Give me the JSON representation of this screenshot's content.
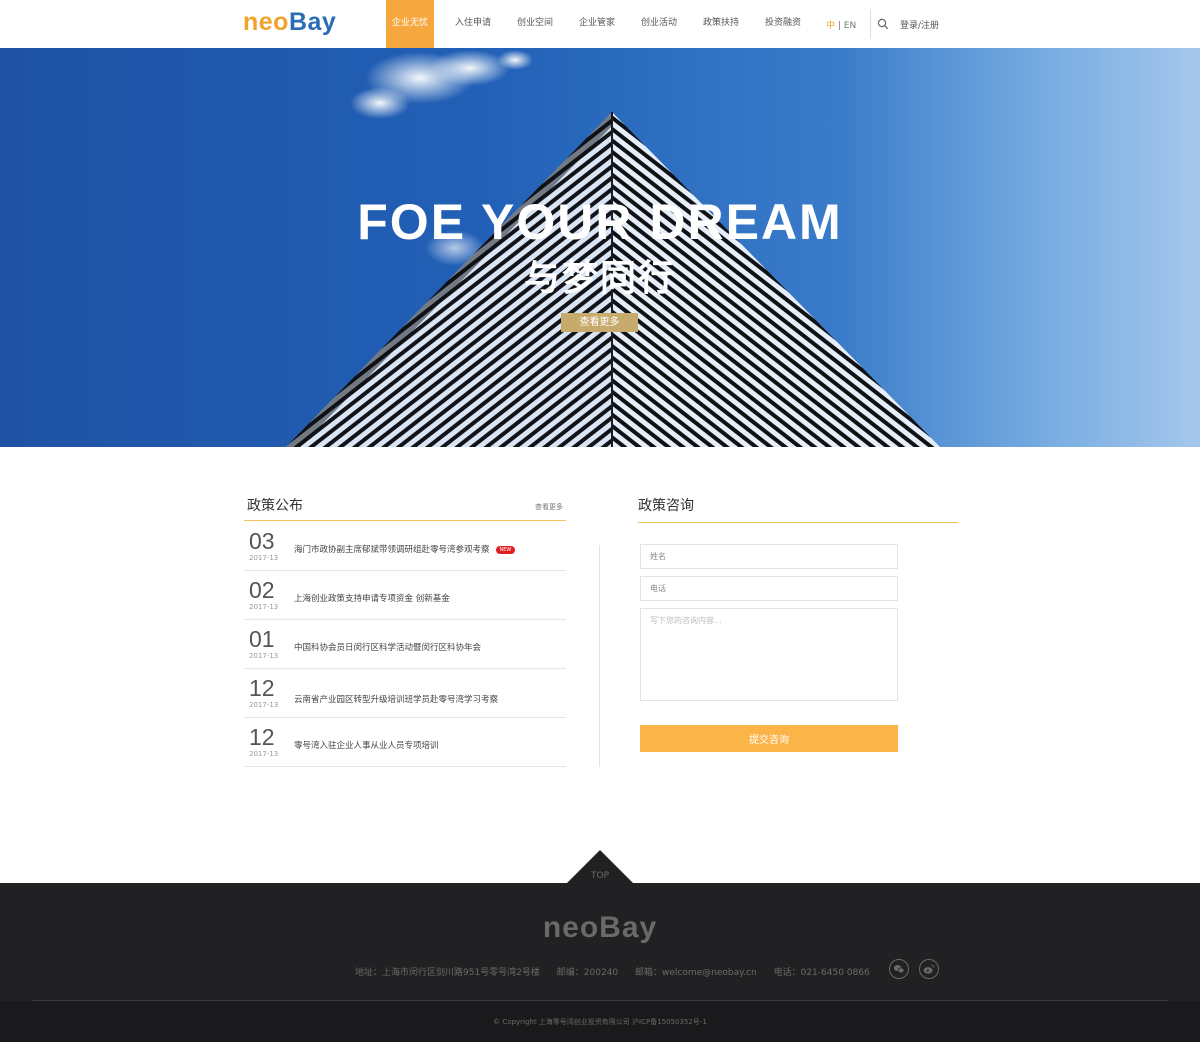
{
  "header": {
    "logo_a": "neo",
    "logo_b": "Bay",
    "nav": [
      {
        "label": "企业无忧"
      },
      {
        "label": "入住申请"
      },
      {
        "label": "创业空间"
      },
      {
        "label": "企业管家"
      },
      {
        "label": "创业活动"
      },
      {
        "label": "政策扶持"
      },
      {
        "label": "投资融资"
      }
    ],
    "lang_zh": "中",
    "lang_sep": " | ",
    "lang_en": "EN",
    "login": "登录/注册"
  },
  "hero": {
    "title": "FOE YOUR DREAM",
    "subtitle": "与梦同行",
    "button": "查看更多"
  },
  "policy": {
    "title": "政策公布",
    "more": "查看更多",
    "items": [
      {
        "day": "03",
        "ym": "2017-13",
        "title": "海门市政协副主席郁斌带领调研组赴零号湾参观考察",
        "badge": "NEW"
      },
      {
        "day": "02",
        "ym": "2017-13",
        "title": "上海创业政策支持申请专项资金 创新基金"
      },
      {
        "day": "01",
        "ym": "2017-13",
        "title": "中国科协会员日闵行区科学活动暨闵行区科协年会"
      },
      {
        "day": "12",
        "ym": "2017-13",
        "title": "云南省产业园区转型升级培训班学员赴零号湾学习考察"
      },
      {
        "day": "12",
        "ym": "2017-13",
        "title": "零号湾入驻企业人事从业人员专项培训"
      }
    ]
  },
  "consult": {
    "title": "政策咨询",
    "name_placeholder": "姓名",
    "phone_placeholder": "电话",
    "message_placeholder": "写下您的咨询内容...",
    "submit": "提交咨询"
  },
  "footer": {
    "top": "TOP",
    "logo": "neoBay",
    "address": "地址：上海市闵行区剑川路951号零号湾2号楼",
    "postcode": "邮编：200240",
    "email": "邮箱：welcome@neobay.cn",
    "phone": "电话：021-6450 0866",
    "copyright": "© Copyright 上海零号湾创业投资有限公司 沪ICP备15050352号-1",
    "social": [
      "wechat-icon",
      "weibo-icon"
    ]
  },
  "colors": {
    "accent": "#f6a83e",
    "brand_blue": "#2a6db4",
    "hero_button": "#c7ab6c",
    "new_badge": "#e11f1f",
    "footer_bg": "#212124"
  }
}
